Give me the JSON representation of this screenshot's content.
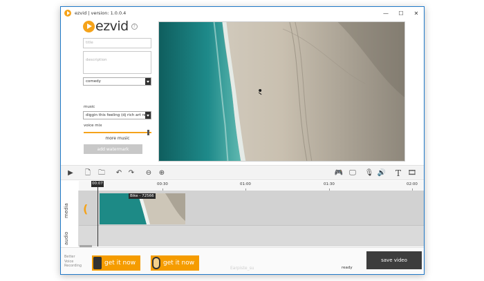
{
  "window": {
    "title": "ezvid | version: 1.0.0.4",
    "controls": [
      "—",
      "☐",
      "✕"
    ]
  },
  "logo": {
    "text": "ezvid",
    "help": "?"
  },
  "form": {
    "title_placeholder": "title",
    "description_placeholder": "description",
    "genre": "comedy",
    "music_label": "music",
    "music_value": "diggin this feeling (dj rich art rem",
    "voice_mix_label": "voice mix",
    "voice_mix_level": 0.97,
    "more_music": "more music",
    "add_watermark": "add watermark"
  },
  "toolbar": {
    "left_icons": [
      "play-icon",
      "new-file-icon",
      "open-folder-icon",
      "undo-icon",
      "redo-icon",
      "zoom-out-icon",
      "zoom-in-icon"
    ],
    "right_icons": [
      "gamepad-icon",
      "monitor-icon",
      "microphone-icon",
      "speaker-icon",
      "text-icon",
      "film-icon"
    ],
    "glyphs": {
      "play": "▶",
      "new": "🗋",
      "open": "🗀",
      "undo": "↶",
      "redo": "↷",
      "zoomout": "⊖",
      "zoomin": "⊕",
      "gamepad": "🎮",
      "monitor": "🖵",
      "mic": "🎙",
      "speaker": "🔊",
      "text": "T",
      "film": "🎞"
    }
  },
  "timeline": {
    "playhead": "00:07",
    "ticks": [
      "00:30",
      "01:00",
      "01:30",
      "02:00"
    ],
    "tracks": [
      "media",
      "audio"
    ],
    "clip_label": "Bike - 72566"
  },
  "bottom": {
    "promo_text": "Better\nVoice\nRecording",
    "promo1": "get it now",
    "promo2": "get it now",
    "faint_text": "Earpiste_su",
    "status": "ready",
    "save_video": "save video"
  },
  "colors": {
    "accent": "#f5a31a",
    "promo": "#f59c00",
    "window_border": "#1f78c8",
    "save_button": "#3d3d3d"
  }
}
